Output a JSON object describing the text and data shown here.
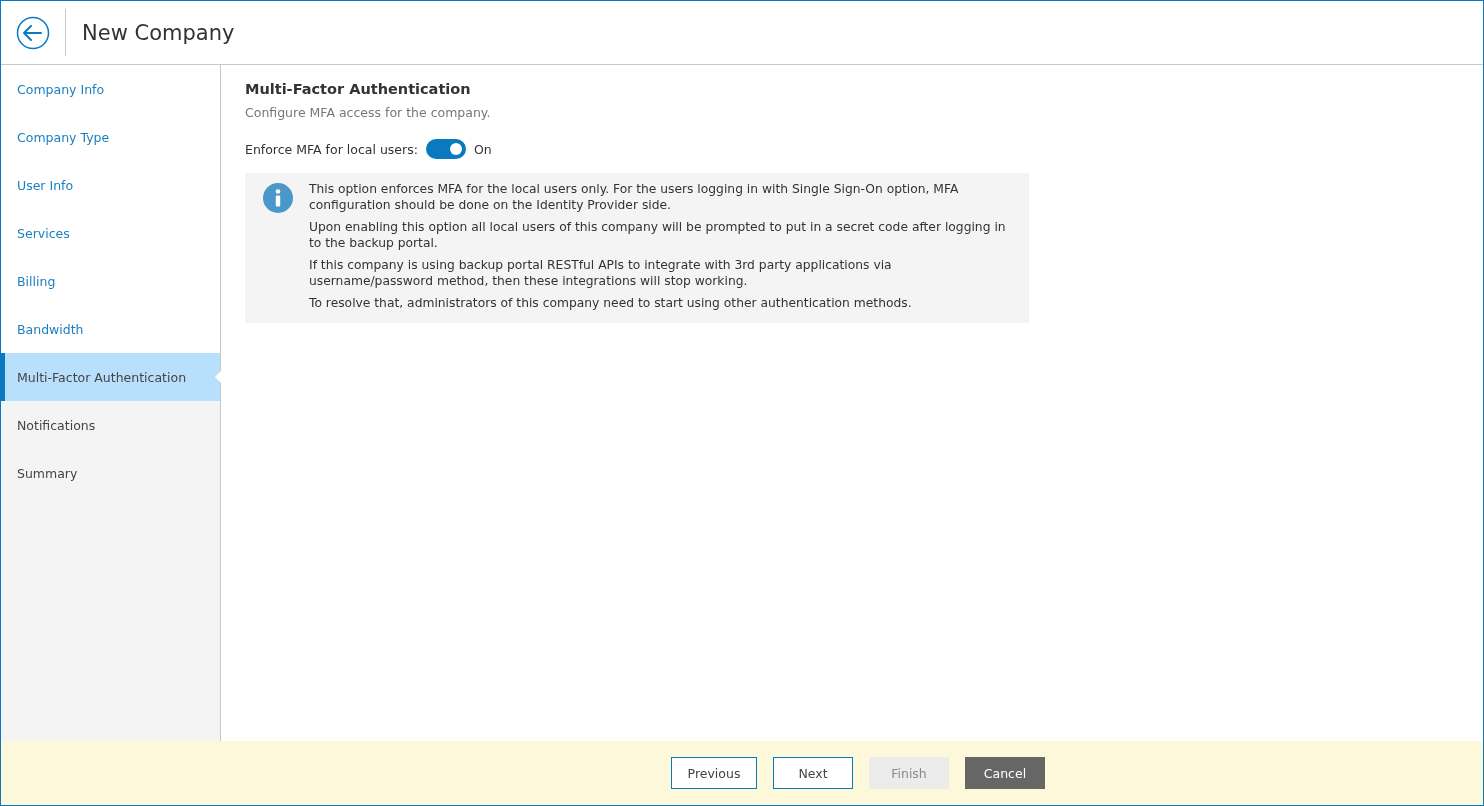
{
  "header": {
    "title": "New Company"
  },
  "steps": [
    {
      "label": "Company Info",
      "selected": false,
      "visited": true
    },
    {
      "label": "Company Type",
      "selected": false,
      "visited": true
    },
    {
      "label": "User Info",
      "selected": false,
      "visited": true
    },
    {
      "label": "Services",
      "selected": false,
      "visited": true
    },
    {
      "label": "Billing",
      "selected": false,
      "visited": true
    },
    {
      "label": "Bandwidth",
      "selected": false,
      "visited": true
    },
    {
      "label": "Multi-Factor Authentication",
      "selected": true,
      "visited": true
    },
    {
      "label": "Notifications",
      "selected": false,
      "visited": false
    },
    {
      "label": "Summary",
      "selected": false,
      "visited": false
    }
  ],
  "section": {
    "title": "Multi-Factor Authentication",
    "subtitle": "Configure MFA access for the company."
  },
  "toggle": {
    "label": "Enforce MFA for local users:",
    "on": true,
    "state_text": "On"
  },
  "info": [
    "This option enforces MFA for the local users only. For the users logging in with Single Sign-On option, MFA configuration should be done on the Identity Provider side.",
    "Upon enabling this option all local users of this company will be prompted to put in a secret code after logging in to the backup portal.",
    "If this company is using backup portal RESTful APIs to integrate with 3rd party applications via username/password method, then these integrations will stop working.",
    "To resolve that, administrators of this company need to start using other authentication methods."
  ],
  "buttons": [
    {
      "label": "Previous",
      "kind": "outline",
      "disabled": false
    },
    {
      "label": "Next",
      "kind": "outline",
      "disabled": false
    },
    {
      "label": "Finish",
      "kind": "outline",
      "disabled": true
    },
    {
      "label": "Cancel",
      "kind": "dark",
      "disabled": false
    }
  ]
}
